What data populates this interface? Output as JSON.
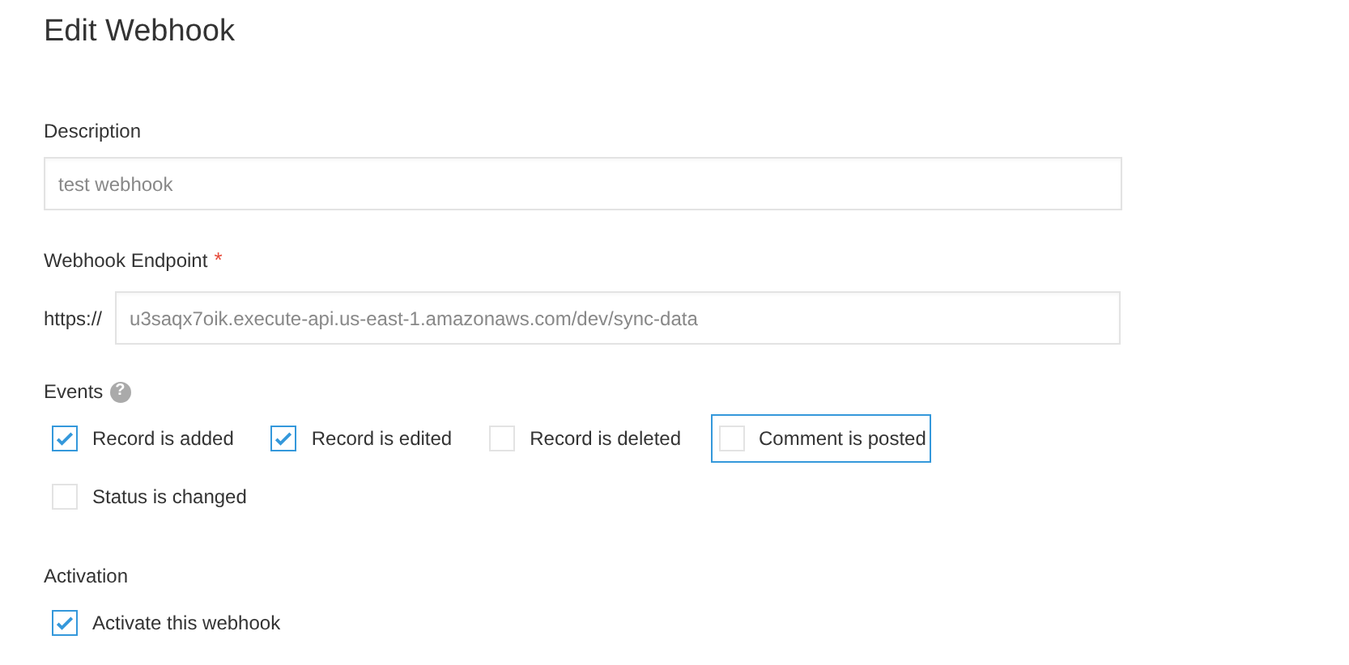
{
  "title": "Edit Webhook",
  "description": {
    "label": "Description",
    "value": "test webhook"
  },
  "endpoint": {
    "label": "Webhook Endpoint",
    "required_mark": "*",
    "prefix": "https://",
    "value": "u3saqx7oik.execute-api.us-east-1.amazonaws.com/dev/sync-data"
  },
  "events": {
    "label": "Events",
    "help_icon": "?",
    "rows": [
      [
        {
          "label": "Record is added",
          "checked": true,
          "focused": false
        },
        {
          "label": "Record is edited",
          "checked": true,
          "focused": false
        },
        {
          "label": "Record is deleted",
          "checked": false,
          "focused": false
        },
        {
          "label": "Comment is posted",
          "checked": false,
          "focused": true
        }
      ],
      [
        {
          "label": "Status is changed",
          "checked": false,
          "focused": false
        }
      ]
    ]
  },
  "activation": {
    "label": "Activation",
    "option": {
      "label": "Activate this webhook",
      "checked": true
    }
  }
}
